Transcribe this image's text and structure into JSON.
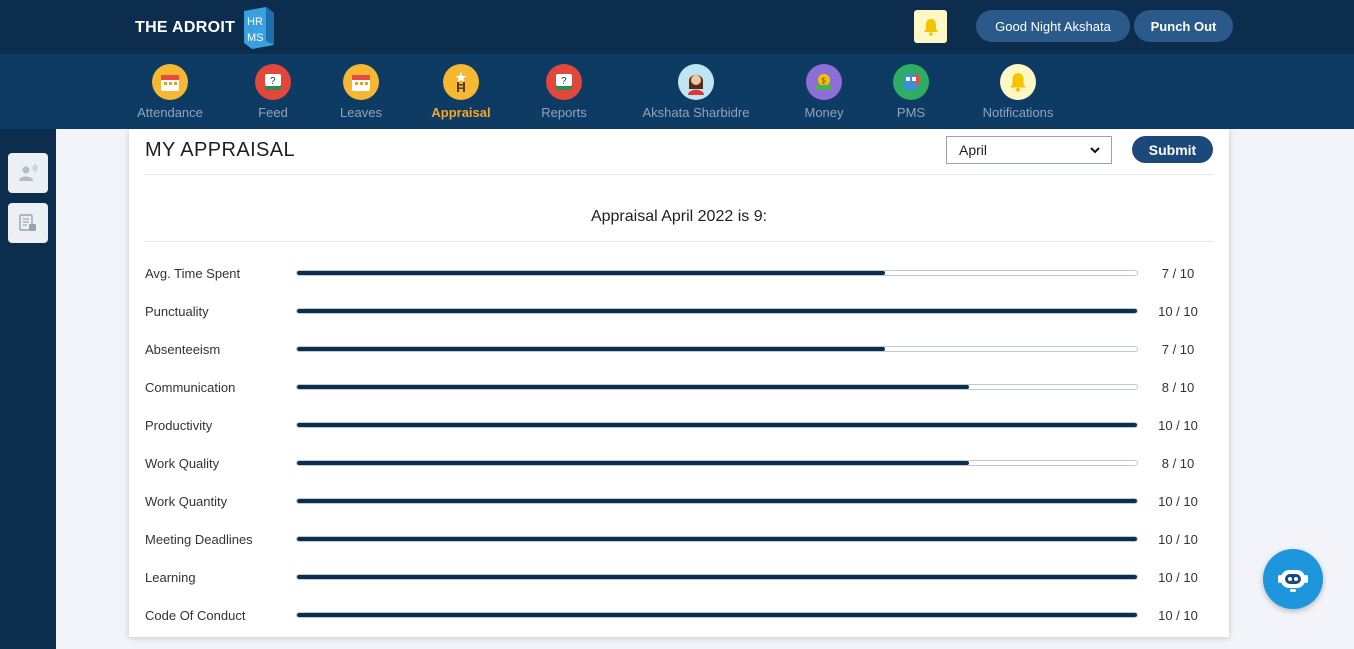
{
  "header": {
    "brand": "THE ADROIT",
    "logo_text": "HRMS",
    "greeting": "Good Night Akshata",
    "punch_label": "Punch Out"
  },
  "nav": {
    "items": [
      {
        "label": "Attendance",
        "icon": "calendar-icon"
      },
      {
        "label": "Feed",
        "icon": "feed-icon"
      },
      {
        "label": "Leaves",
        "icon": "calendar-icon"
      },
      {
        "label": "Appraisal",
        "icon": "ladder-star-icon",
        "active": true
      },
      {
        "label": "Reports",
        "icon": "reports-icon"
      },
      {
        "label": "Akshata Sharbidre",
        "icon": "avatar-icon"
      },
      {
        "label": "Money",
        "icon": "money-icon"
      },
      {
        "label": "PMS",
        "icon": "pms-icon"
      },
      {
        "label": "Notifications",
        "icon": "bell-icon"
      }
    ]
  },
  "sidebar": {
    "items": [
      {
        "icon": "user-broadcast-icon"
      },
      {
        "icon": "report-doc-icon"
      }
    ]
  },
  "page": {
    "title": "MY APPRAISAL",
    "month_select": {
      "selected": "April"
    },
    "submit_label": "Submit",
    "summary": "Appraisal April 2022 is 9:"
  },
  "metrics": [
    {
      "label": "Avg. Time Spent",
      "score": 7,
      "max": 10,
      "display": "7 / 10"
    },
    {
      "label": "Punctuality",
      "score": 10,
      "max": 10,
      "display": "10 / 10"
    },
    {
      "label": "Absenteeism",
      "score": 7,
      "max": 10,
      "display": "7 / 10"
    },
    {
      "label": "Communication",
      "score": 8,
      "max": 10,
      "display": "8 / 10"
    },
    {
      "label": "Productivity",
      "score": 10,
      "max": 10,
      "display": "10 / 10"
    },
    {
      "label": "Work Quality",
      "score": 8,
      "max": 10,
      "display": "8 / 10"
    },
    {
      "label": "Work Quantity",
      "score": 10,
      "max": 10,
      "display": "10 / 10"
    },
    {
      "label": "Meeting Deadlines",
      "score": 10,
      "max": 10,
      "display": "10 / 10"
    },
    {
      "label": "Learning",
      "score": 10,
      "max": 10,
      "display": "10 / 10"
    },
    {
      "label": "Code Of Conduct",
      "score": 10,
      "max": 10,
      "display": "10 / 10"
    }
  ],
  "colors": {
    "topbar": "#0d2d4f",
    "navbar": "#0e3b63",
    "accent_active": "#f5a623",
    "progress_fill": "#0d2d4f",
    "button": "#1b4a7a",
    "chatbot": "#1e96de"
  },
  "chatbot": {
    "icon": "chatbot-icon"
  }
}
